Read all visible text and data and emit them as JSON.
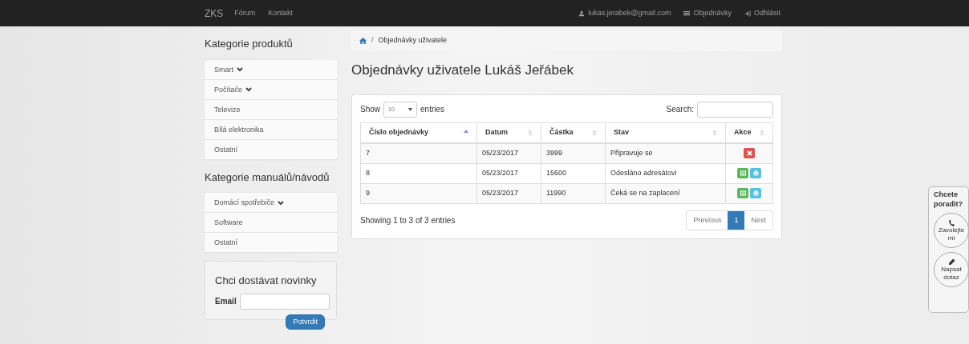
{
  "navbar": {
    "brand": "ZKS",
    "links": [
      "Fórum",
      "Kontakt"
    ],
    "right_links": [
      {
        "kind": "user",
        "label": "lukas.jerabek@gmail.com"
      },
      {
        "kind": "list",
        "label": "Objednávky"
      },
      {
        "kind": "logout",
        "label": "Odhlásit"
      }
    ]
  },
  "sidebar": {
    "sections": [
      {
        "title": "Kategorie produktů",
        "items": [
          {
            "label": "Smart",
            "expandable": true
          },
          {
            "label": "Počítače",
            "expandable": true
          },
          {
            "label": "Televize",
            "expandable": false
          },
          {
            "label": "Bílá elektronika",
            "expandable": false
          },
          {
            "label": "Ostatní",
            "expandable": false
          }
        ]
      },
      {
        "title": "Kategorie manuálů/návodů",
        "items": [
          {
            "label": "Domácí spotřebiče",
            "expandable": true
          },
          {
            "label": "Software",
            "expandable": false
          },
          {
            "label": "Ostatní",
            "expandable": false
          }
        ]
      }
    ],
    "newsletter": {
      "title": "Chci dostávat novinky",
      "email_label": "Email",
      "button": "Potvrdit"
    }
  },
  "breadcrumb": {
    "separator": "/",
    "items": [
      "Objednávky uživatele"
    ]
  },
  "page_title": "Objednávky uživatele Lukáš Jeřábek",
  "table": {
    "show_label": "Show",
    "page_size": "10",
    "entries_label": "entries",
    "search_label": "Search:",
    "columns": [
      {
        "label": "Číslo objednávky",
        "sorted": true
      },
      {
        "label": "Datum",
        "sorted": false
      },
      {
        "label": "Částka",
        "sorted": false
      },
      {
        "label": "Stav",
        "sorted": false
      },
      {
        "label": "Akce",
        "sorted": false
      }
    ],
    "rows": [
      {
        "cells": [
          "7",
          "05/23/2017",
          "3999",
          "Připravuje se"
        ],
        "actions": [
          {
            "kind": "cancel"
          }
        ]
      },
      {
        "cells": [
          "8",
          "05/23/2017",
          "15600",
          "Odesláno adresátovi"
        ],
        "actions": [
          {
            "kind": "detail"
          },
          {
            "kind": "print"
          }
        ]
      },
      {
        "cells": [
          "9",
          "05/23/2017",
          "11990",
          "Čeká se na zaplacení"
        ],
        "actions": [
          {
            "kind": "detail"
          },
          {
            "kind": "print"
          }
        ]
      }
    ],
    "info": "Showing 1 to 3 of 3 entries",
    "pagination": [
      {
        "label": "Previous",
        "selected": false
      },
      {
        "label": "1",
        "selected": true
      },
      {
        "label": "Next",
        "selected": false
      }
    ]
  },
  "help_widget": {
    "title": "Chcete poradit?",
    "buttons": [
      {
        "kind": "call",
        "label": "Zavolejte mi"
      },
      {
        "kind": "write",
        "label": "Napsat dotaz"
      }
    ]
  }
}
